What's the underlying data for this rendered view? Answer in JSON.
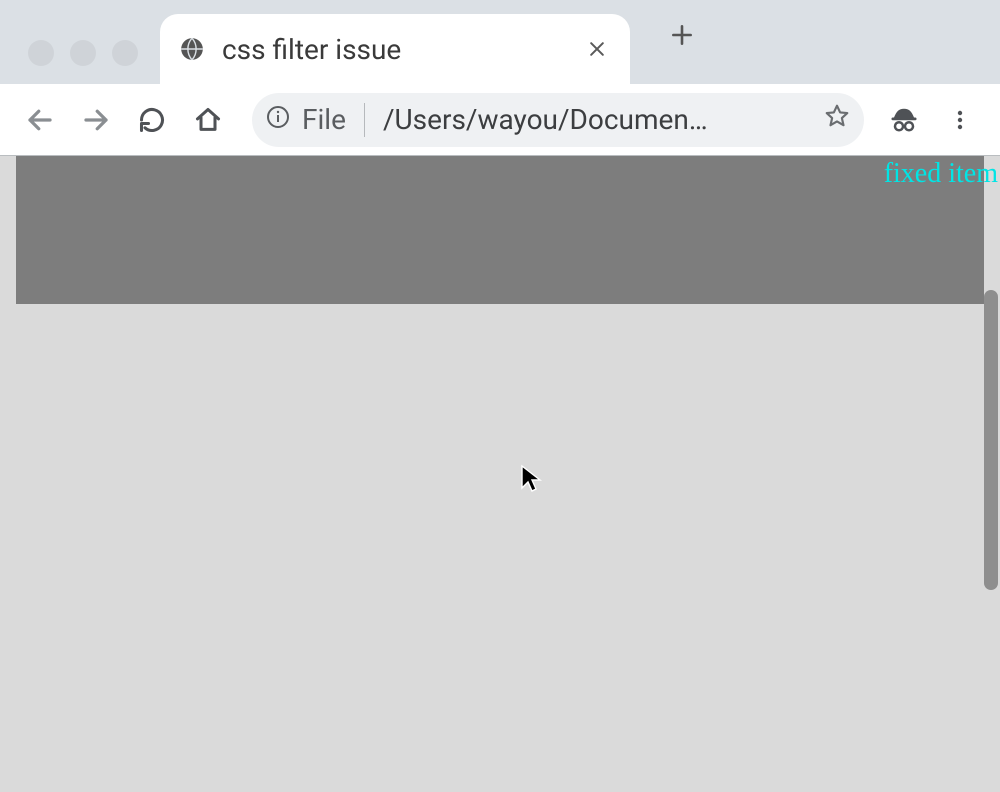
{
  "tab": {
    "title": "css filter issue"
  },
  "omnibox": {
    "scheme": "File",
    "path": "/Users/wayou/Documen…"
  },
  "page": {
    "fixed_label": "fixed item"
  }
}
